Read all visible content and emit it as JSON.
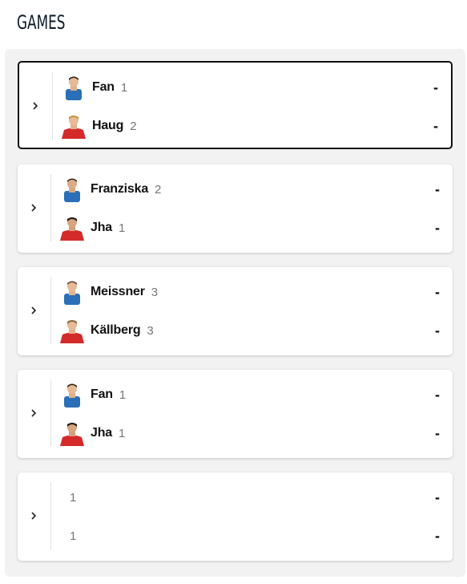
{
  "header": {
    "title": "GAMES"
  },
  "games": [
    {
      "home": {
        "name": "Fan",
        "rank": "1",
        "score": "-",
        "kit": "blue"
      },
      "away": {
        "name": "Haug",
        "rank": "2",
        "score": "-",
        "kit": "red"
      },
      "active": true
    },
    {
      "home": {
        "name": "Franziska",
        "rank": "2",
        "score": "-",
        "kit": "blue"
      },
      "away": {
        "name": "Jha",
        "rank": "1",
        "score": "-",
        "kit": "red"
      },
      "active": false
    },
    {
      "home": {
        "name": "Meissner",
        "rank": "3",
        "score": "-",
        "kit": "blue"
      },
      "away": {
        "name": "Källberg",
        "rank": "3",
        "score": "-",
        "kit": "red"
      },
      "active": false
    },
    {
      "home": {
        "name": "Fan",
        "rank": "1",
        "score": "-",
        "kit": "blue"
      },
      "away": {
        "name": "Jha",
        "rank": "1",
        "score": "-",
        "kit": "red"
      },
      "active": false
    },
    {
      "home": {
        "name": "",
        "rank": "1",
        "score": "-",
        "kit": null
      },
      "away": {
        "name": "",
        "rank": "1",
        "score": "-",
        "kit": null
      },
      "active": false
    }
  ],
  "colors": {
    "blue_kit": "#2a6fb8",
    "red_kit": "#d42a2a",
    "active_border": "#111111",
    "panel_bg": "#f2f2f2"
  },
  "icons": {
    "expand": "chevron-right-icon",
    "player": "player-avatar-icon"
  }
}
